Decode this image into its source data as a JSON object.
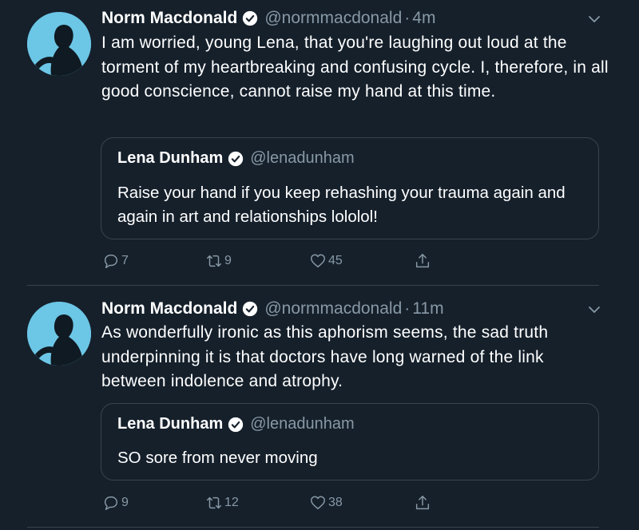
{
  "tweets": [
    {
      "author_name": "Norm Macdonald",
      "handle": "@normmacdonald",
      "separator": "·",
      "time": "4m",
      "text": "I am worried, young Lena, that you're laughing out loud at the torment of my heartbreaking and confusing cycle. I, therefore, in all good conscience, cannot raise my hand at this time.",
      "quote": {
        "author_name": "Lena Dunham",
        "handle": "@lenadunham",
        "text": "Raise your hand if you keep rehashing your trauma again and again in art and relationships lololol!"
      },
      "replies": "7",
      "retweets": "9",
      "likes": "45"
    },
    {
      "author_name": "Norm Macdonald",
      "handle": "@normmacdonald",
      "separator": "·",
      "time": "11m",
      "text": "As wonderfully ironic as this aphorism seems, the sad truth underpinning it is that doctors have long warned of the link between indolence and atrophy.",
      "quote": {
        "author_name": "Lena Dunham",
        "handle": "@lenadunham",
        "text": "SO sore from never moving"
      },
      "replies": "9",
      "retweets": "12",
      "likes": "38"
    }
  ],
  "icons": {
    "verified": "verified-badge-icon",
    "chevron": "chevron-down-icon",
    "reply": "reply-icon",
    "retweet": "retweet-icon",
    "like": "heart-icon",
    "share": "share-icon"
  },
  "colors": {
    "background": "#15202b",
    "text": "#ffffff",
    "secondary": "#8899a6",
    "border": "#38444d",
    "avatar": "#6cc6e6"
  }
}
